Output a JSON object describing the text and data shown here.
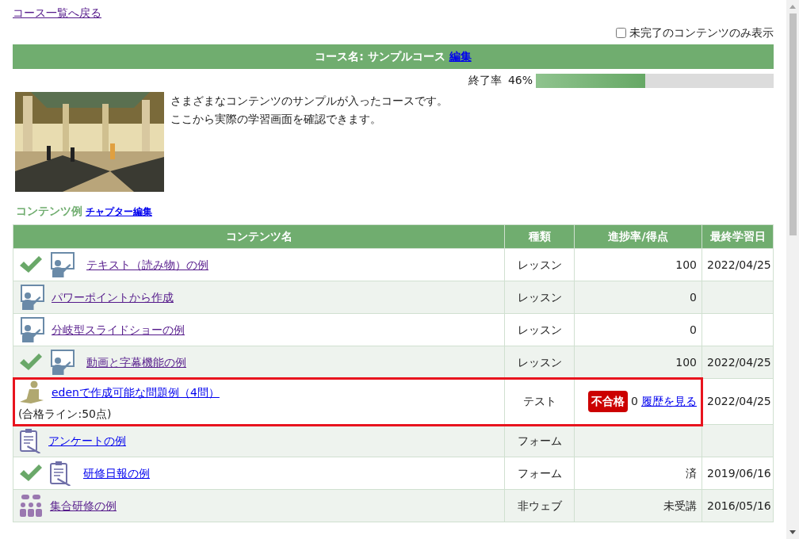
{
  "back_link": {
    "text": "コース一覧へ戻る",
    "visited": true
  },
  "filter": {
    "label": "未完了のコンテンツのみ表示",
    "checked": false
  },
  "course_header": {
    "label": "コース名: サンプルコース",
    "edit_link": "編集"
  },
  "completion": {
    "label": "終了率",
    "percent": "46%",
    "level": 0.46
  },
  "description": [
    "さまざまなコンテンツのサンプルが入ったコースです。",
    "ここから実際の学習画面を確認できます。"
  ],
  "section": {
    "title": "コンテンツ例",
    "edit_link": "チャプター編集"
  },
  "table": {
    "columns": [
      "コンテンツ名",
      "種類",
      "進捗率/得点",
      "最終学習日"
    ],
    "rows": [
      {
        "completed": true,
        "kind": "lesson",
        "title": "テキスト（読み物）の例",
        "visited": true,
        "type": "レッスン",
        "progress": "100",
        "date": "2022/04/25",
        "highlighted": false
      },
      {
        "completed": false,
        "kind": "lesson",
        "title": "パワーポイントから作成",
        "visited": true,
        "type": "レッスン",
        "progress": "0",
        "highlighted": false
      },
      {
        "completed": false,
        "kind": "lesson",
        "title": "分岐型スライドショーの例",
        "visited": true,
        "type": "レッスン",
        "progress": "0",
        "highlighted": false
      },
      {
        "completed": true,
        "kind": "lesson",
        "title": "動画と字幕機能の例",
        "visited": true,
        "type": "レッスン",
        "progress": "100",
        "date": "2022/04/25",
        "highlighted": false
      },
      {
        "completed": false,
        "kind": "test",
        "title": "edenで作成可能な問題例（4問）",
        "visited": false,
        "note": "(合格ライン:50点)",
        "type": "テスト",
        "badge": "不合格",
        "progress": "0",
        "history_link": "履歴を見る",
        "date": "2022/04/25",
        "highlighted": true
      },
      {
        "completed": false,
        "kind": "form",
        "title": "アンケートの例",
        "visited": false,
        "type": "フォーム",
        "highlighted": false
      },
      {
        "completed": true,
        "kind": "form",
        "title": "研修日報の例",
        "visited": false,
        "type": "フォーム",
        "progress": "済",
        "date": "2019/06/16",
        "highlighted": false
      },
      {
        "completed": false,
        "kind": "group",
        "title": "集合研修の例",
        "visited": true,
        "type": "非ウェブ",
        "progress": "未受講",
        "date": "2016/05/16",
        "highlighted": false
      }
    ]
  }
}
